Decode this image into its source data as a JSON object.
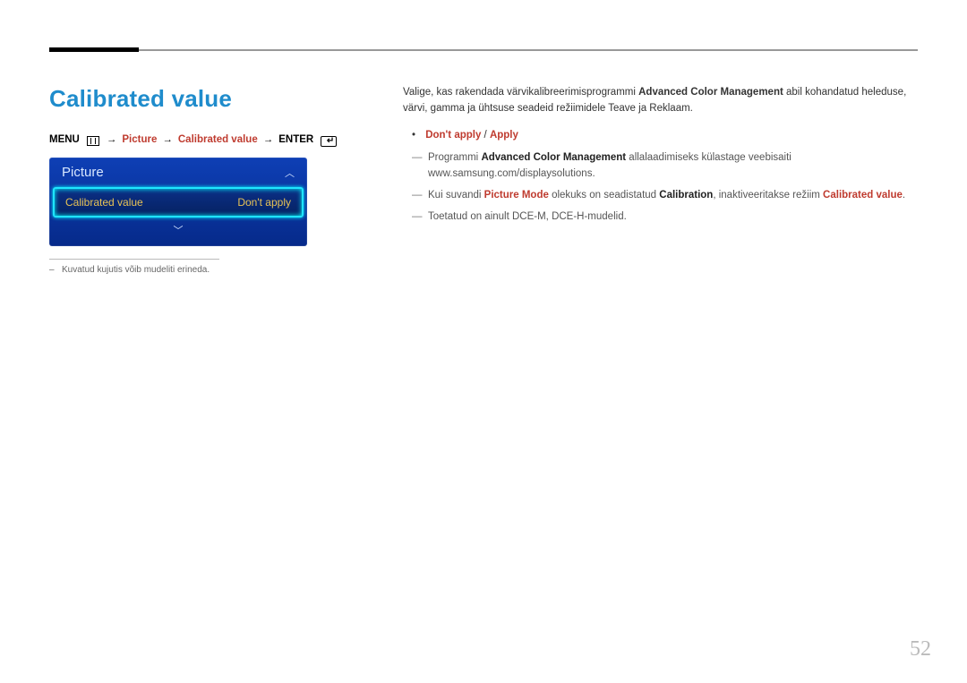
{
  "title": "Calibrated value",
  "breadcrumb": {
    "menu": "MENU",
    "arrow": "→",
    "picture": "Picture",
    "calibrated": "Calibrated value",
    "enter": "ENTER"
  },
  "osd": {
    "header": "Picture",
    "row_label": "Calibrated value",
    "row_value": "Don't apply"
  },
  "footnote": "Kuvatud kujutis võib mudeliti erineda.",
  "right": {
    "para1_a": "Valige, kas rakendada värvikalibreerimisprogrammi ",
    "para1_b_bold": "Advanced Color Management",
    "para1_c": " abil kohandatud heleduse, värvi, gamma ja ühtsuse seadeid režiimidele Teave ja Reklaam.",
    "opt_dont": "Don't apply",
    "opt_slash": " / ",
    "opt_apply": "Apply",
    "note1_a": "Programmi ",
    "note1_b_bold": "Advanced Color Management",
    "note1_c": " allalaadimiseks külastage veebisaiti www.samsung.com/displaysolutions.",
    "note2_a": "Kui suvandi ",
    "note2_b_red": "Picture Mode",
    "note2_c": " olekuks on seadistatud ",
    "note2_d_bold": "Calibration",
    "note2_e": ", inaktiveeritakse režiim ",
    "note2_f_red": "Calibrated value",
    "note2_g": ".",
    "note3": "Toetatud on ainult DCE-M, DCE-H-mudelid."
  },
  "page_number": "52"
}
